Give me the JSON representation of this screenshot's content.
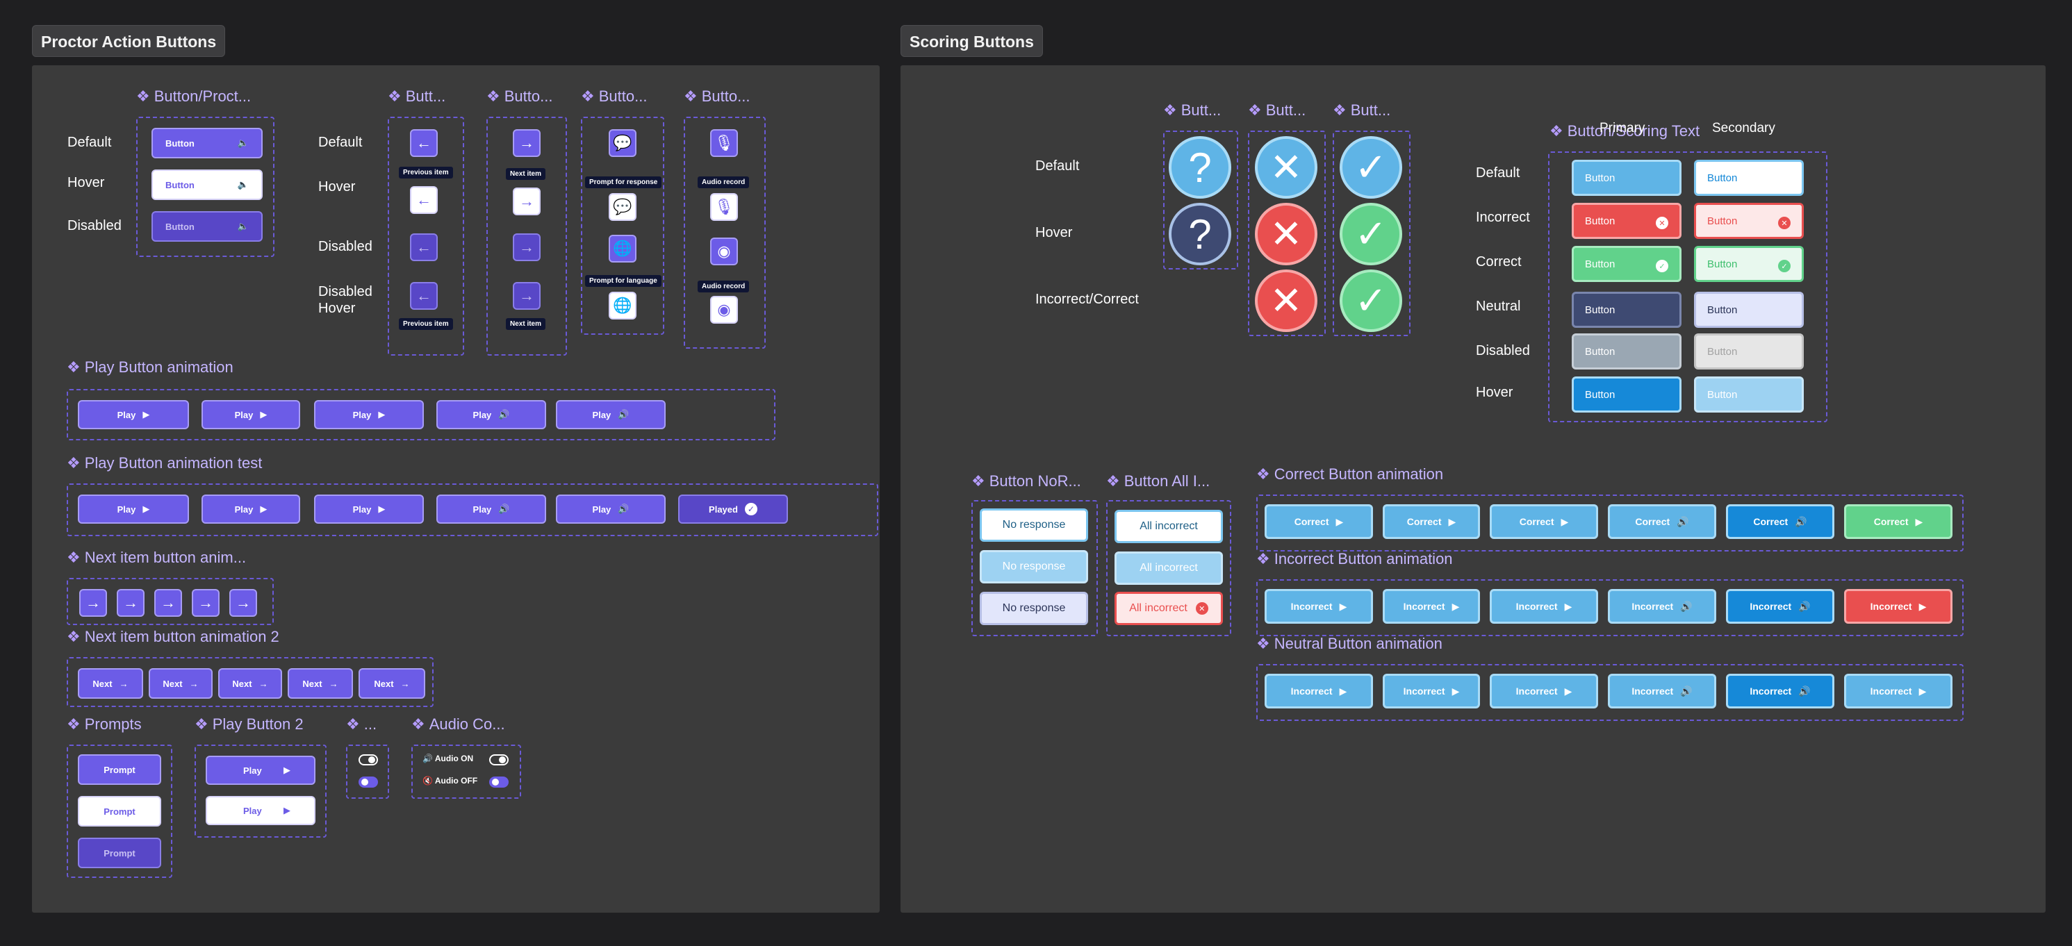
{
  "sections": {
    "proctor_title": "Proctor Action Buttons",
    "scoring_title": "Scoring Buttons"
  },
  "proctor": {
    "button_proctor": {
      "title": "Button/Proct...",
      "states": [
        "Default",
        "Hover",
        "Disabled"
      ],
      "button_label": "Button"
    },
    "nav_states": [
      "Default",
      "Hover",
      "Disabled",
      "Disabled Hover"
    ],
    "nav_titles": [
      "Butt...",
      "Butto...",
      "Butto...",
      "Butto..."
    ],
    "tooltips": {
      "previous": "Previous item",
      "next": "Next item",
      "prompt_response": "Prompt for response",
      "prompt_language": "Prompt for language",
      "audio_record": "Audio record"
    },
    "play_anim": {
      "title": "Play Button animation",
      "labels": [
        "Play",
        "Play",
        "Play",
        "Play",
        "Play"
      ]
    },
    "play_anim_test": {
      "title": "Play Button animation test",
      "labels": [
        "Play",
        "Play",
        "Play",
        "Play",
        "Play",
        "Played"
      ]
    },
    "next_anim": {
      "title": "Next item button anim..."
    },
    "next_anim2": {
      "title": "Next item button animation 2",
      "labels": [
        "Next",
        "Next",
        "Next",
        "Next",
        "Next"
      ]
    },
    "prompts": {
      "title": "Prompts",
      "labels": [
        "Prompt",
        "Prompt",
        "Prompt"
      ]
    },
    "play2": {
      "title": "Play Button 2",
      "labels": [
        "Play",
        "Play"
      ]
    },
    "toggle_title": "...",
    "audio": {
      "title": "Audio Co...",
      "on": "Audio ON",
      "off": "Audio OFF"
    }
  },
  "scoring": {
    "circle_titles": [
      "Butt...",
      "Butt...",
      "Butt..."
    ],
    "circle_states": [
      "Default",
      "Hover",
      "Incorrect/Correct"
    ],
    "text_title": "Button/Scoring Text",
    "columns": [
      "Primary",
      "Secondary"
    ],
    "text_states": [
      "Default",
      "Incorrect",
      "Correct",
      "Neutral",
      "Disabled",
      "Hover"
    ],
    "button_label": "Button",
    "noresp": {
      "title": "Button NoR...",
      "labels": [
        "No response",
        "No response",
        "No response"
      ]
    },
    "allincorrect": {
      "title": "Button All I...",
      "labels": [
        "All incorrect",
        "All incorrect",
        "All incorrect"
      ]
    },
    "correct_anim": {
      "title": "Correct Button animation",
      "labels": [
        "Correct",
        "Correct",
        "Correct",
        "Correct",
        "Correct",
        "Correct"
      ]
    },
    "incorrect_anim": {
      "title": "Incorrect Button animation",
      "labels": [
        "Incorrect",
        "Incorrect",
        "Incorrect",
        "Incorrect",
        "Incorrect",
        "Incorrect"
      ]
    },
    "neutral_anim": {
      "title": "Neutral Button animation",
      "labels": [
        "Incorrect",
        "Incorrect",
        "Incorrect",
        "Incorrect",
        "Incorrect",
        "Incorrect"
      ]
    }
  },
  "colors": {
    "purple": "#6c5ce7",
    "blue": "#5fb4e6",
    "green": "#61d28b",
    "red": "#e94f4f"
  }
}
